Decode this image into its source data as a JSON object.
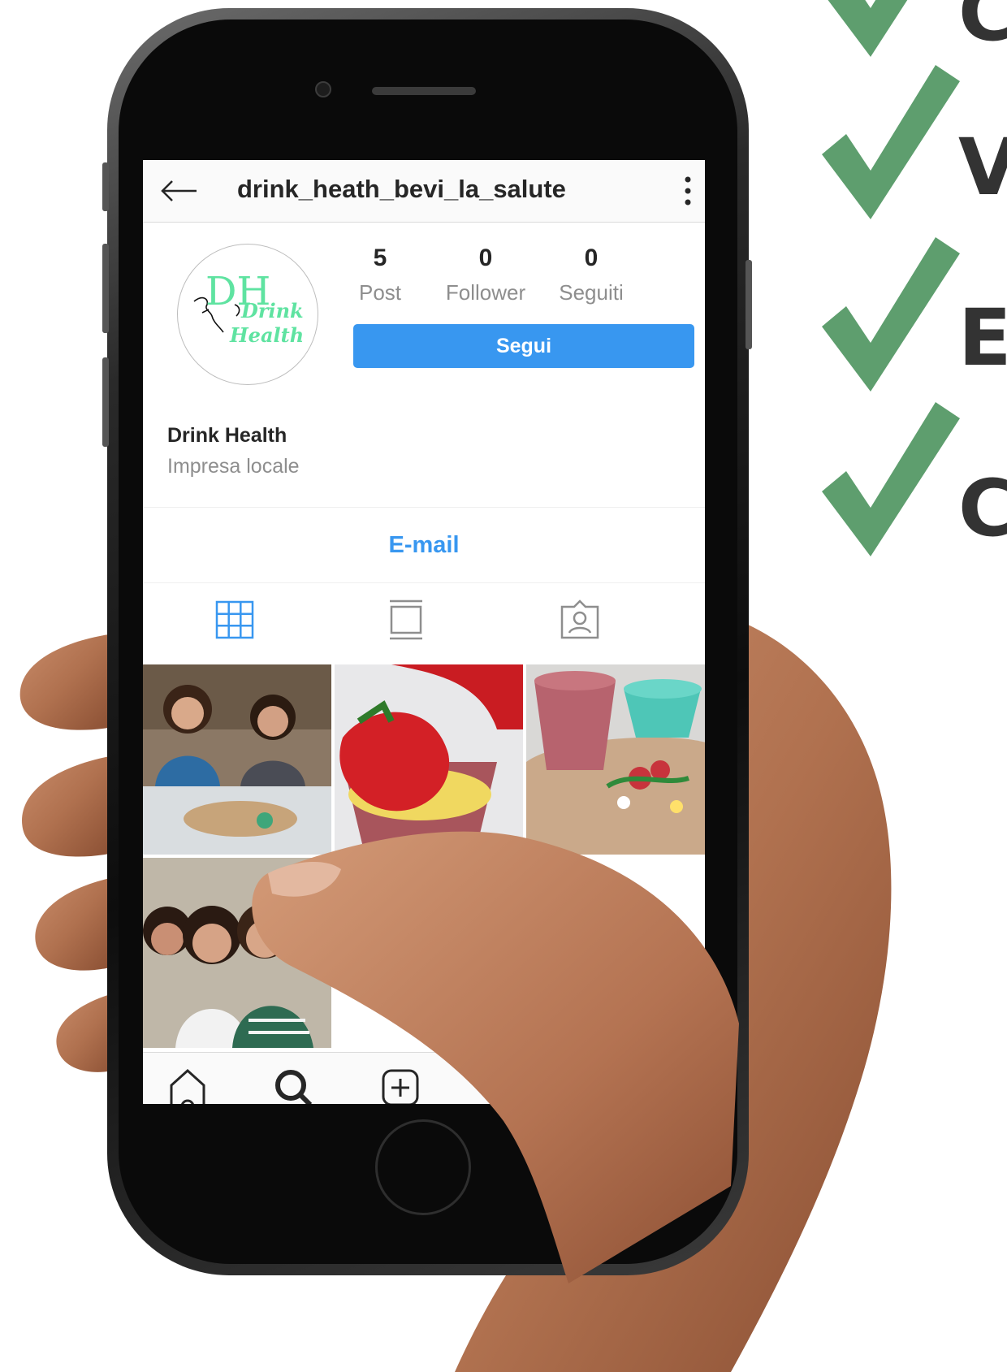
{
  "profile": {
    "username": "drink_heath_bevi_la_salute",
    "display_name": "Drink Health",
    "category": "Impresa locale",
    "logo_initials": "DH",
    "logo_line1": "Drink",
    "logo_line2": "Health",
    "stats": [
      {
        "value": "5",
        "label": "Post"
      },
      {
        "value": "0",
        "label": "Follower"
      },
      {
        "value": "0",
        "label": "Seguiti"
      }
    ],
    "follow_label": "Segui",
    "email_label": "E-mail"
  },
  "tabs": [
    {
      "icon": "grid-icon"
    },
    {
      "icon": "feed-icon"
    },
    {
      "icon": "tagged-icon"
    }
  ],
  "bottom_nav": [
    {
      "icon": "home-icon"
    },
    {
      "icon": "search-icon"
    },
    {
      "icon": "add-post-icon"
    }
  ],
  "side_checklist": [
    {
      "letter": "C"
    },
    {
      "letter": "V"
    },
    {
      "letter": "E"
    },
    {
      "letter": "C"
    }
  ],
  "colors": {
    "accent_blue": "#3897f0",
    "check_green": "#5e9e6e",
    "logo_green": "#5fe3a1"
  }
}
